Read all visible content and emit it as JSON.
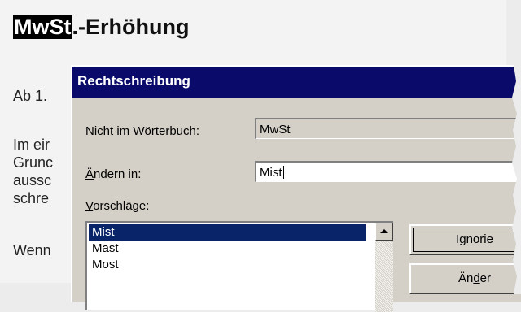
{
  "document": {
    "title_highlighted": "MwSt",
    "title_rest": ".-Erhöhung",
    "lines": [
      "Ab 1.",
      "Im eir",
      "Grunc",
      "aussc",
      "schre",
      "Wenn"
    ]
  },
  "dialog": {
    "title": "Rechtschreibung",
    "not_in_dictionary_label": "Nicht im Wörterbuch:",
    "not_in_dictionary_value": "MwSt",
    "change_to_label_mnemonic": "Ä",
    "change_to_label_rest": "ndern in:",
    "change_to_value": "Mist",
    "suggestions_label_mnemonic": "V",
    "suggestions_label_rest": "orschläge:",
    "suggestions": [
      "Mist",
      "Mast",
      "Most"
    ],
    "selected_suggestion": "Mist",
    "buttons": {
      "ignore_pre": "I",
      "ignore_mnemonic": "g",
      "ignore_post": "norie",
      "change_pre": "Än",
      "change_mnemonic": "d",
      "change_post": "er"
    }
  },
  "colors": {
    "titlebar": "#0a0a6b",
    "selection": "#0a246a",
    "dialog_face": "#d4d0c8"
  }
}
